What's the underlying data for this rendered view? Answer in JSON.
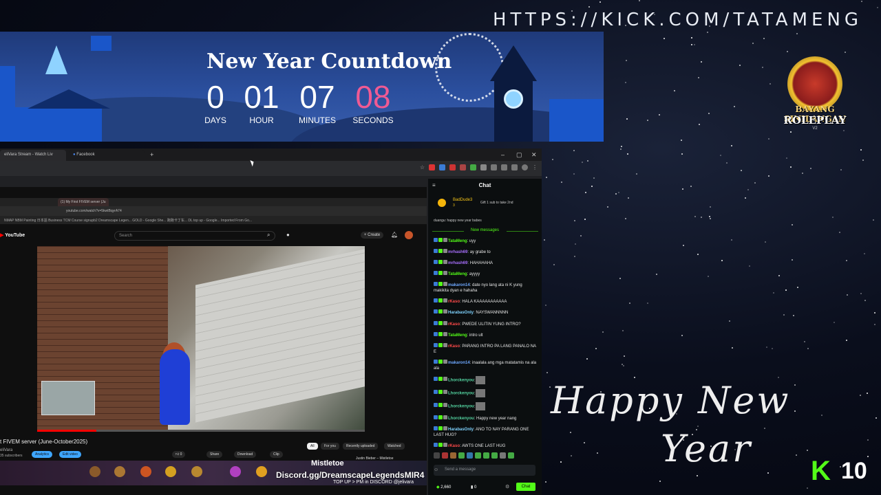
{
  "overlay": {
    "kick_url": "HTTPS://KICK.COM/TATAMENG",
    "logo_line1": "BAYANG SINILANGAN",
    "logo_line2": "ROLEPLAY",
    "logo_v": "V2",
    "happy_line1": "Happy New",
    "happy_line2": "Year",
    "kick_count": "10"
  },
  "countdown": {
    "title": "New Year Countdown",
    "days": "0",
    "days_label": "DAYS",
    "hours": "01",
    "hours_label": "HOUR",
    "minutes": "07",
    "minutes_label": "MINUTES",
    "seconds": "08",
    "seconds_label": "SECONDS"
  },
  "browser": {
    "tabs": [
      {
        "label": "eliVara Stream - Watch Liv"
      },
      {
        "label": "Facebook"
      }
    ],
    "new_tab": "+",
    "win_min": "–",
    "win_max": "▢",
    "win_close": "✕"
  },
  "nested": {
    "tab_label": "(1) My First FIVEM server (Ju",
    "url": "youtube.com/watch?v=5kwtBqyrA74",
    "bookmarks": "NMAP   NBM   Painting   日本語   Business   TCM   Course   signupb2   Dreamscape Legen...   GOLD - Google She...   跑跑卡丁车...   DL top up - Google...   Imported From Go...",
    "yt_logo": "YouTube",
    "search_placeholder": "Search",
    "create": "+ Create",
    "video_title": "t FIVEM server (June-October2025)",
    "channel": "eliVara",
    "subs": "35 subscribers",
    "analytics": "Analytics",
    "edit_video": "Edit video",
    "likes": "0",
    "share": "Share",
    "download": "Download",
    "clip": "Clip",
    "chips": [
      "All",
      "For you",
      "Recently uploaded",
      "Watched"
    ],
    "mistletoe": "Mistletoe",
    "mistletoe_sub": "Justin Bieber – Mistletoe",
    "discord": "Discord.gg/DreamscapeLegendsMIR4",
    "topup": "TOP UP > PM in DISCORD @jelivara"
  },
  "chat": {
    "title": "Chat",
    "pinned_name": "BadDude3",
    "pinned_count": "3",
    "pinned_msg": "Gift 1 sub to take 2nd",
    "cut_msg": "duangu: happy new year babes",
    "new_messages": "New messages",
    "messages": [
      {
        "user": "TataMeng",
        "text": ": uyy",
        "color": "#53fc18"
      },
      {
        "user": "mrhash69",
        "text": ": ay grabe to",
        "color": "#a970ff"
      },
      {
        "user": "mrhash69",
        "text": ": HAHAHAHA",
        "color": "#a970ff"
      },
      {
        "user": "TataMeng",
        "text": ": ayyyy",
        "color": "#53fc18"
      },
      {
        "user": "makaron14",
        "text": ": date nyo lang ata ni K yung makikita dyan e hahaha",
        "color": "#6ea8ff"
      },
      {
        "user": "rKaso",
        "text": ": HALA KAAAAAAAAAAA",
        "color": "#ff4a4a"
      },
      {
        "user": "HarabasOnly",
        "text": ": NAYSWANNNNN",
        "color": "#7fd3ff"
      },
      {
        "user": "rKaso",
        "text": ": PWEDE ULITIN YUNG INTRO?",
        "color": "#ff4a4a"
      },
      {
        "user": "TataMeng",
        "text": ": intro ult",
        "color": "#53fc18"
      },
      {
        "user": "rKaso",
        "text": ": PARANG INTRO PA LANG PANALO NA E",
        "color": "#ff4a4a"
      },
      {
        "user": "makaron14",
        "text": ": inaalala ang mga matatamis na ala ala",
        "color": "#6ea8ff"
      },
      {
        "user": "Lhorckenyou",
        "text": ":",
        "color": "#53d3a0",
        "emote": true
      },
      {
        "user": "Lhorckenyou",
        "text": ":",
        "color": "#53d3a0",
        "emote": true
      },
      {
        "user": "Lhorckenyou",
        "text": ":",
        "color": "#53d3a0",
        "emote": true
      },
      {
        "user": "Lhorckenyou",
        "text": ": Happy new year nang",
        "color": "#53d3a0"
      },
      {
        "user": "HarabasOnly",
        "text": ": ANO TO NAY PARANG ONE LAST HUG?",
        "color": "#7fd3ff"
      },
      {
        "user": "rKaso",
        "text": ": AWTS ONE LAST HUG",
        "color": "#ff4a4a"
      }
    ],
    "send_placeholder": "Send a message",
    "points": "2,660",
    "viewers": "0",
    "chat_button": "Chat"
  },
  "colors": {
    "kick_green": "#53fc18",
    "countdown_seconds": "#ef5a93",
    "banner_blue": "#2b4f9e"
  },
  "progress": {
    "video_watched": 0.18
  }
}
